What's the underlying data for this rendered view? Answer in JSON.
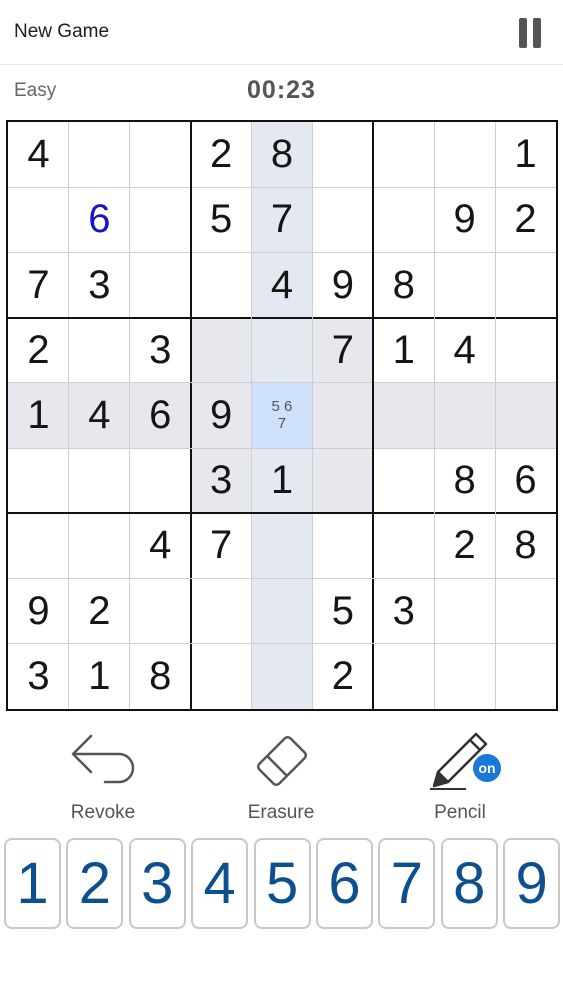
{
  "header": {
    "new_game_label": "New Game",
    "pause_icon": "pause-icon"
  },
  "status": {
    "difficulty": "Easy",
    "timer": "00:23"
  },
  "board": {
    "cells": [
      [
        "4",
        "",
        "",
        "2",
        "8",
        "",
        "",
        "",
        "1"
      ],
      [
        "",
        "6",
        "",
        "5",
        "7",
        "",
        "",
        "9",
        "2"
      ],
      [
        "7",
        "3",
        "",
        "",
        "4",
        "9",
        "8",
        "",
        ""
      ],
      [
        "2",
        "",
        "3",
        "",
        "",
        "7",
        "1",
        "4",
        ""
      ],
      [
        "1",
        "4",
        "6",
        "9",
        "",
        "",
        "",
        "",
        ""
      ],
      [
        "",
        "",
        "",
        "3",
        "1",
        "",
        "",
        "8",
        "6"
      ],
      [
        "",
        "",
        "4",
        "7",
        "",
        "",
        "",
        "2",
        "8"
      ],
      [
        "9",
        "2",
        "",
        "",
        "",
        "5",
        "3",
        "",
        ""
      ],
      [
        "3",
        "1",
        "8",
        "",
        "",
        "2",
        "",
        "",
        ""
      ]
    ],
    "user_entries": [
      [
        1,
        1
      ]
    ],
    "selected": [
      4,
      4
    ],
    "notes": [
      {
        "row": 4,
        "col": 4,
        "text": "5 6\n7"
      }
    ],
    "colors": {
      "given": "#151515",
      "user": "#1414c8",
      "selected": "#cfe0fb",
      "highlight": "#e6e8ed"
    }
  },
  "tools": {
    "revoke_label": "Revoke",
    "erasure_label": "Erasure",
    "pencil_label": "Pencil",
    "pencil_badge": "on"
  },
  "numpad": [
    "1",
    "2",
    "3",
    "4",
    "5",
    "6",
    "7",
    "8",
    "9"
  ]
}
